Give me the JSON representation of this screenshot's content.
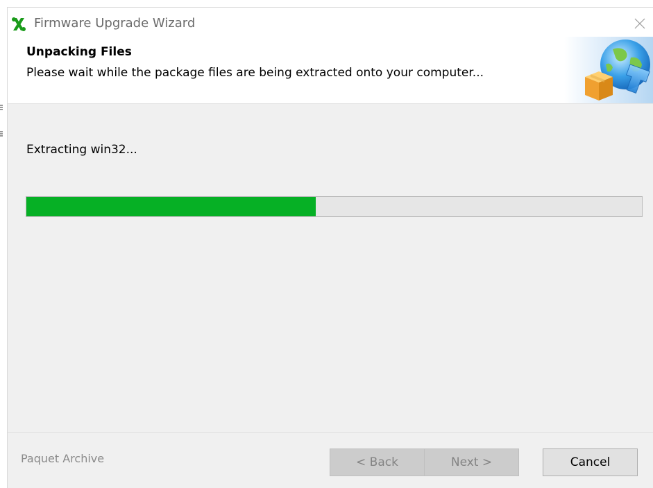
{
  "window": {
    "title": "Firmware Upgrade Wizard",
    "app_icon": "green-tools-icon",
    "close_icon": "close-icon"
  },
  "header": {
    "title": "Unpacking Files",
    "subtitle": "Please wait while the package files are being extracted onto your computer...",
    "graphic_icon": "globe-package-download-icon"
  },
  "status": {
    "text": "Extracting win32...",
    "progress_percent": 47
  },
  "footer": {
    "brand": "Paquet Archive",
    "back_label": "< Back",
    "next_label": "Next >",
    "cancel_label": "Cancel"
  },
  "colors": {
    "progress_fill": "#06b025",
    "progress_track": "#e6e6e6",
    "app_icon_green": "#1a9b1a",
    "globe_blue": "#2d8fd8",
    "box_orange": "#f0a030"
  }
}
